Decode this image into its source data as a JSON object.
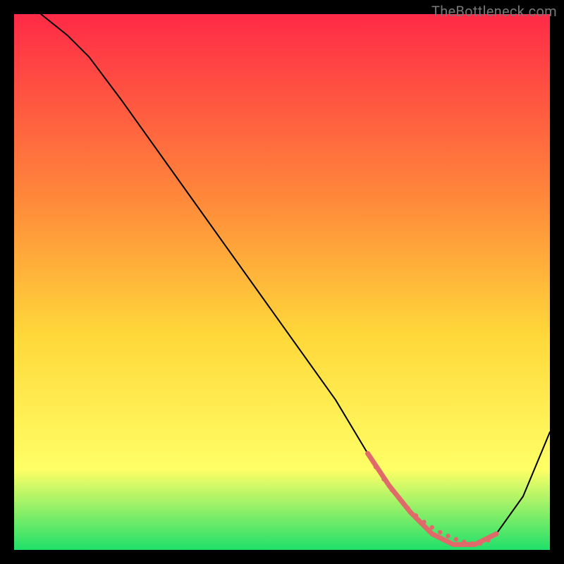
{
  "watermark": "TheBottleneck.com",
  "chart_data": {
    "type": "line",
    "title": "",
    "xlabel": "",
    "ylabel": "",
    "xlim": [
      0,
      100
    ],
    "ylim": [
      0,
      100
    ],
    "grid": false,
    "legend": false,
    "gradient_colors": {
      "top": "#ff2a47",
      "mid_upper": "#ff8a3a",
      "mid": "#ffd83a",
      "mid_lower": "#ffff66",
      "bottom": "#1fe06a"
    },
    "series": [
      {
        "name": "bottleneck-curve",
        "color": "#000000",
        "stroke_width": 2,
        "x": [
          5,
          10,
          14,
          20,
          30,
          40,
          50,
          60,
          66,
          70,
          74,
          78,
          82,
          86,
          90,
          95,
          100
        ],
        "y": [
          100,
          96,
          92,
          84,
          70,
          56,
          42,
          28,
          18,
          12,
          7,
          3,
          1,
          1,
          3,
          10,
          22
        ]
      },
      {
        "name": "highlight-segment",
        "color": "#e06a6a",
        "stroke_width": 7,
        "x": [
          66,
          70,
          74,
          78,
          82,
          86,
          90
        ],
        "y": [
          18,
          12,
          7,
          3,
          1,
          1,
          3
        ]
      }
    ],
    "highlight_dots": {
      "color": "#e06a6a",
      "radius": 3.2,
      "x": [
        66,
        67.5,
        69,
        70.5,
        72,
        73.5,
        75,
        76.5,
        78,
        79.5,
        81,
        82.5,
        84,
        85.5,
        87,
        88.5,
        90
      ],
      "y": [
        18,
        15.5,
        13.2,
        11.2,
        9.4,
        7.8,
        6.4,
        5.2,
        4.2,
        3.3,
        2.6,
        2.0,
        1.5,
        1.2,
        1.2,
        1.8,
        3.0
      ]
    }
  }
}
